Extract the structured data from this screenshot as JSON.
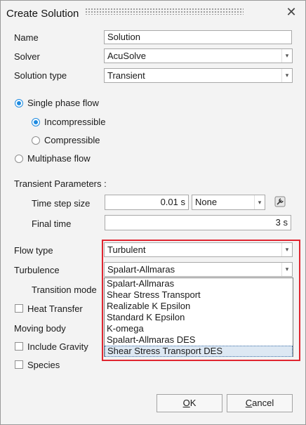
{
  "window": {
    "title": "Create Solution",
    "close_glyph": "✕"
  },
  "fields": {
    "name_label": "Name",
    "name_value": "Solution",
    "solver_label": "Solver",
    "solver_value": "AcuSolve",
    "solution_type_label": "Solution type",
    "solution_type_value": "Transient"
  },
  "flow": {
    "single_phase_label": "Single phase flow",
    "incompressible_label": "Incompressible",
    "compressible_label": "Compressible",
    "multiphase_label": "Multiphase flow",
    "selected_phase": "Single phase flow",
    "selected_compressibility": "Incompressible"
  },
  "transient": {
    "section_label": "Transient Parameters :",
    "time_step_label": "Time step size",
    "time_step_value": "0.01 s",
    "time_step_unit_select": "None",
    "final_time_label": "Final time",
    "final_time_value": "3 s"
  },
  "flow_type": {
    "label": "Flow type",
    "value": "Turbulent"
  },
  "turbulence": {
    "label": "Turbulence",
    "value": "Spalart-Allmaras",
    "options": [
      "Spalart-Allmaras",
      "Shear Stress Transport",
      "Realizable K Epsilon",
      "Standard K Epsilon",
      "K-omega",
      "Spalart-Allmaras DES",
      "Shear Stress Transport DES"
    ],
    "highlighted_option": "Shear Stress Transport DES"
  },
  "transition_mode_label": "Transition mode",
  "heat_transfer_label": "Heat Transfer",
  "moving_body_label": "Moving body",
  "include_gravity_label": "Include Gravity",
  "species_label": "Species",
  "buttons": {
    "ok_mnemonic": "O",
    "ok_rest": "K",
    "cancel_mnemonic": "C",
    "cancel_rest": "ancel"
  },
  "colors": {
    "accent": "#1e8be0",
    "highlight_box": "#e02530",
    "dropdown_selection": "#dde8f3"
  },
  "icons": {
    "dropdown_arrow": "▾",
    "workflow_icon": "wrench-icon"
  }
}
